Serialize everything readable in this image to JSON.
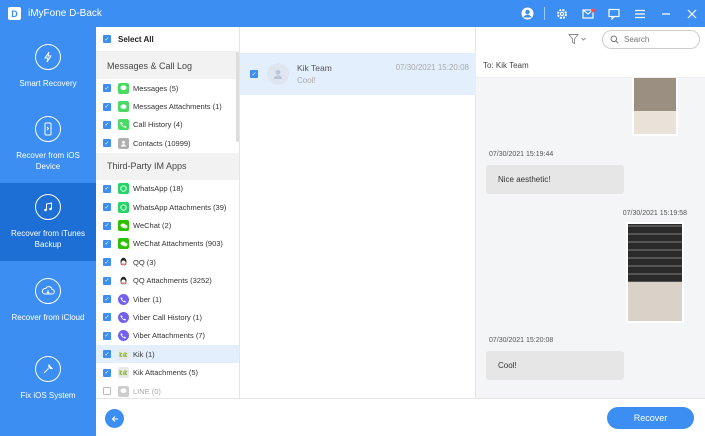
{
  "app": {
    "title": "iMyFone D-Back",
    "logo": "D"
  },
  "sidebar": {
    "items": [
      {
        "label": "Smart Recovery",
        "icon": "smart-recovery-icon"
      },
      {
        "label": "Recover from iOS Device",
        "icon": "ios-device-icon"
      },
      {
        "label": "Recover from iTunes Backup",
        "icon": "itunes-backup-icon",
        "active": true
      },
      {
        "label": "Recover from iCloud",
        "icon": "icloud-icon"
      },
      {
        "label": "Fix iOS System",
        "icon": "wrench-icon"
      }
    ]
  },
  "categories": {
    "select_all": "Select All",
    "groups": [
      {
        "title": "Messages & Call Log",
        "items": [
          {
            "label": "Messages (5)",
            "color": "#4cd964"
          },
          {
            "label": "Messages Attachments (1)",
            "color": "#4cd964"
          },
          {
            "label": "Call History (4)",
            "color": "#4cd964"
          },
          {
            "label": "Contacts (10999)",
            "color": "#b0b0b0"
          }
        ]
      },
      {
        "title": "Third-Party IM Apps",
        "items": [
          {
            "label": "WhatsApp (18)",
            "color": "#25d366"
          },
          {
            "label": "WhatsApp Attachments (39)",
            "color": "#25d366"
          },
          {
            "label": "WeChat (2)",
            "color": "#2dc100"
          },
          {
            "label": "WeChat Attachments (903)",
            "color": "#2dc100"
          },
          {
            "label": "QQ (3)",
            "color": "#222222"
          },
          {
            "label": "QQ Attachments (3252)",
            "color": "#222222"
          },
          {
            "label": "Viber (1)",
            "color": "#7360f2"
          },
          {
            "label": "Viber Call History (1)",
            "color": "#7360f2"
          },
          {
            "label": "Viber Attachments (7)",
            "color": "#7360f2"
          },
          {
            "label": "Kik (1)",
            "color": "#82bc23",
            "selected": true
          },
          {
            "label": "Kik Attachments (5)",
            "color": "#82bc23"
          },
          {
            "label": "LINE (0)",
            "color": "#cccccc",
            "unchecked": true
          }
        ]
      }
    ]
  },
  "conversation": {
    "name": "Kik Team",
    "preview": "Cool!",
    "time": "07/30/2021 15:20:08"
  },
  "search": {
    "placeholder": "Search"
  },
  "chat": {
    "to_label": "To: Kik Team",
    "messages": [
      {
        "timestamp": "07/30/2021 15:19:44",
        "text": "Nice aesthetic!"
      },
      {
        "timestamp": "07/30/2021 15:19:58"
      },
      {
        "timestamp": "07/30/2021 15:20:08",
        "text": "Cool!"
      }
    ]
  },
  "footer": {
    "recover_label": "Recover"
  }
}
